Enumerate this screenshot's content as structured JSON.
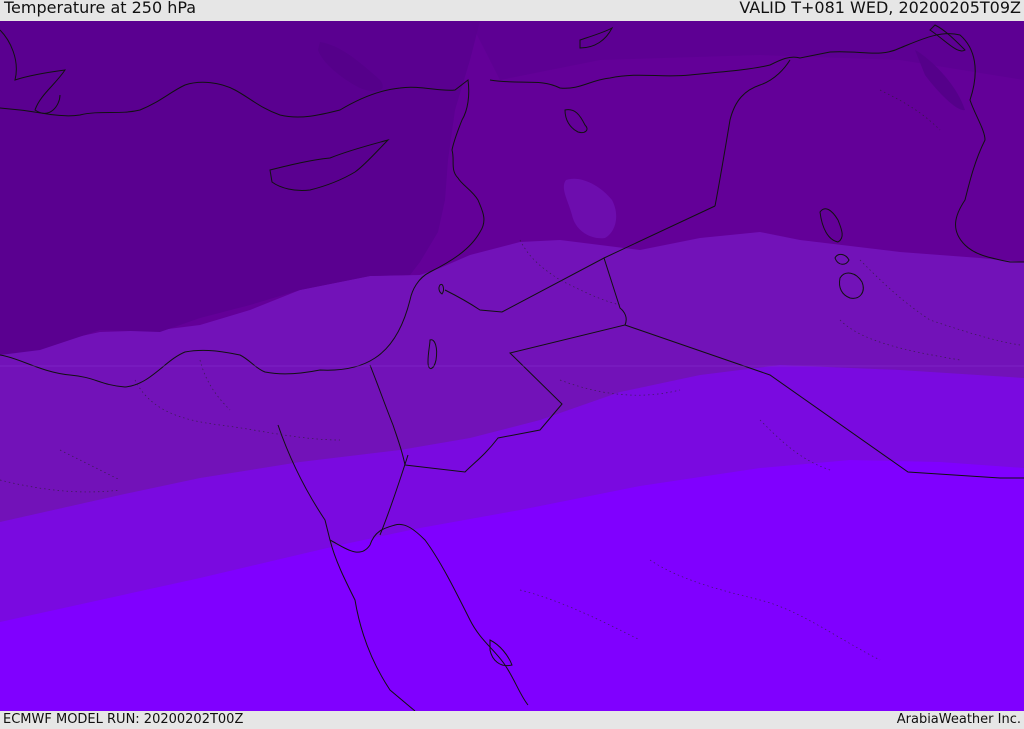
{
  "header": {
    "title": "Temperature at 250 hPa",
    "valid": "VALID T+081 WED, 20200205T09Z"
  },
  "footer": {
    "model_run": "ECMWF MODEL RUN: 20200202T00Z",
    "credit": "ArabiaWeather Inc."
  },
  "map": {
    "field": "Temperature at 250 hPa",
    "band_colors": {
      "darkest": "#5a0090",
      "dark": "#630098",
      "mid_dark": "#7212b8",
      "mid": "#7a0ae0",
      "light": "#8000ff"
    },
    "boundary_color": "#111111"
  }
}
